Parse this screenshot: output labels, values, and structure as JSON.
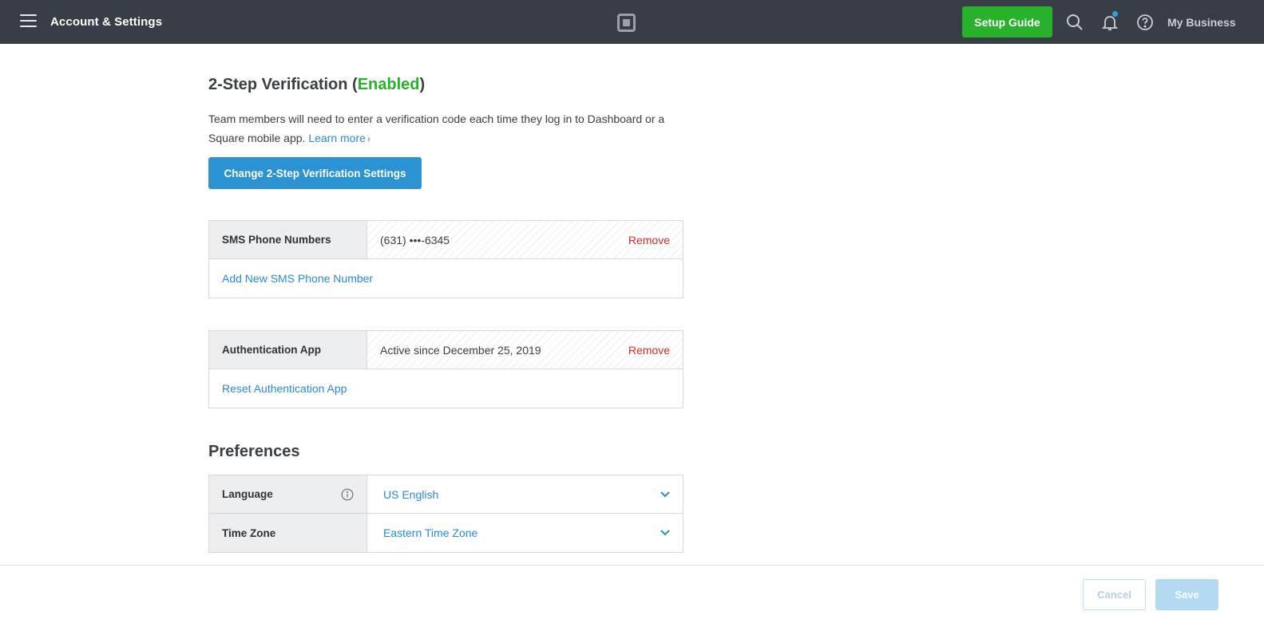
{
  "header": {
    "title": "Account & Settings",
    "setup_guide_label": "Setup Guide",
    "business_label": "My Business"
  },
  "two_step": {
    "title_prefix": "2-Step Verification (",
    "status": "Enabled",
    "title_suffix": ")",
    "status_color": "#28b12b",
    "description": "Team members will need to enter a verification code each time they log in to Dashboard or a Square mobile app.",
    "learn_more": "Learn more",
    "change_button": "Change 2-Step Verification Settings"
  },
  "sms": {
    "label": "SMS Phone Numbers",
    "value": "(631) •••-6345",
    "remove_label": "Remove",
    "add_label": "Add New SMS Phone Number"
  },
  "auth_app": {
    "label": "Authentication App",
    "value": "Active since December 25, 2019",
    "remove_label": "Remove",
    "reset_label": "Reset Authentication App"
  },
  "preferences": {
    "title": "Preferences",
    "language_label": "Language",
    "language_value": "US English",
    "timezone_label": "Time Zone",
    "timezone_value": "Eastern Time Zone"
  },
  "footer": {
    "cancel_label": "Cancel",
    "save_label": "Save"
  },
  "colors": {
    "topbar": "#373e45",
    "accent_blue": "#2b93d1",
    "success_green": "#28b12b",
    "danger_red": "#d12b2b"
  }
}
